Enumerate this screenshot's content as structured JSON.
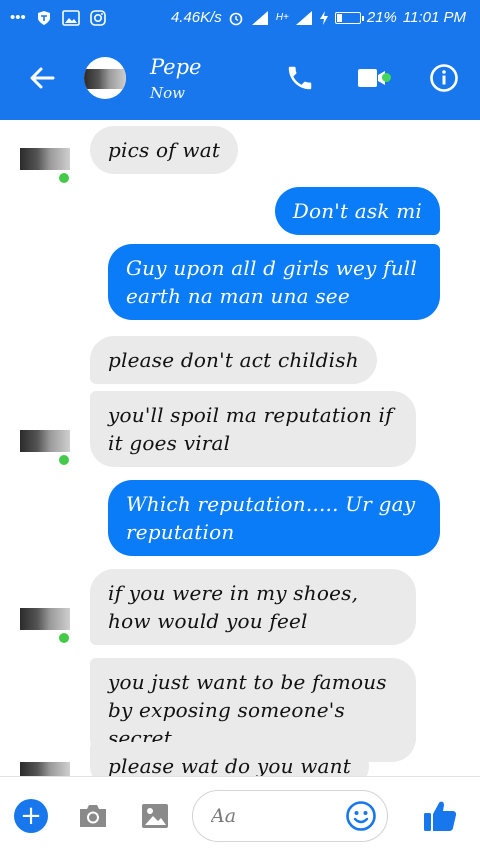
{
  "status_bar": {
    "dots": "•••",
    "speed": "4.46K/s",
    "network": "H+",
    "battery_percent": "21%",
    "battery_level": 0.21,
    "time": "11:01 PM"
  },
  "header": {
    "contact_name": "Pepe",
    "contact_status": "Now",
    "brand_color": "#1877ec",
    "online_color": "#42d65e"
  },
  "messages": [
    {
      "direction": "in",
      "text": "pics of wat"
    },
    {
      "direction": "out",
      "text": "Don't ask mi"
    },
    {
      "direction": "out",
      "text": "Guy upon all d girls wey full earth na man una see"
    },
    {
      "direction": "in",
      "text": "please don't act childish"
    },
    {
      "direction": "in",
      "text": "you'll spoil ma reputation if it goes viral"
    },
    {
      "direction": "out",
      "text": "Which reputation..... Ur gay reputation"
    },
    {
      "direction": "in",
      "text": "if you were in my shoes, how would you feel"
    },
    {
      "direction": "in",
      "text": "you just want to be famous by exposing someone's secret"
    },
    {
      "direction": "in",
      "text": "please wat do you want"
    }
  ],
  "composer": {
    "placeholder": "Aa",
    "value": ""
  },
  "icons": {
    "back": "arrow-left-icon",
    "call": "phone-icon",
    "video": "video-camera-icon",
    "info": "info-icon",
    "add": "plus-icon",
    "camera": "camera-icon",
    "gallery": "image-icon",
    "emoji": "smiley-icon",
    "like": "thumbs-up-icon"
  }
}
